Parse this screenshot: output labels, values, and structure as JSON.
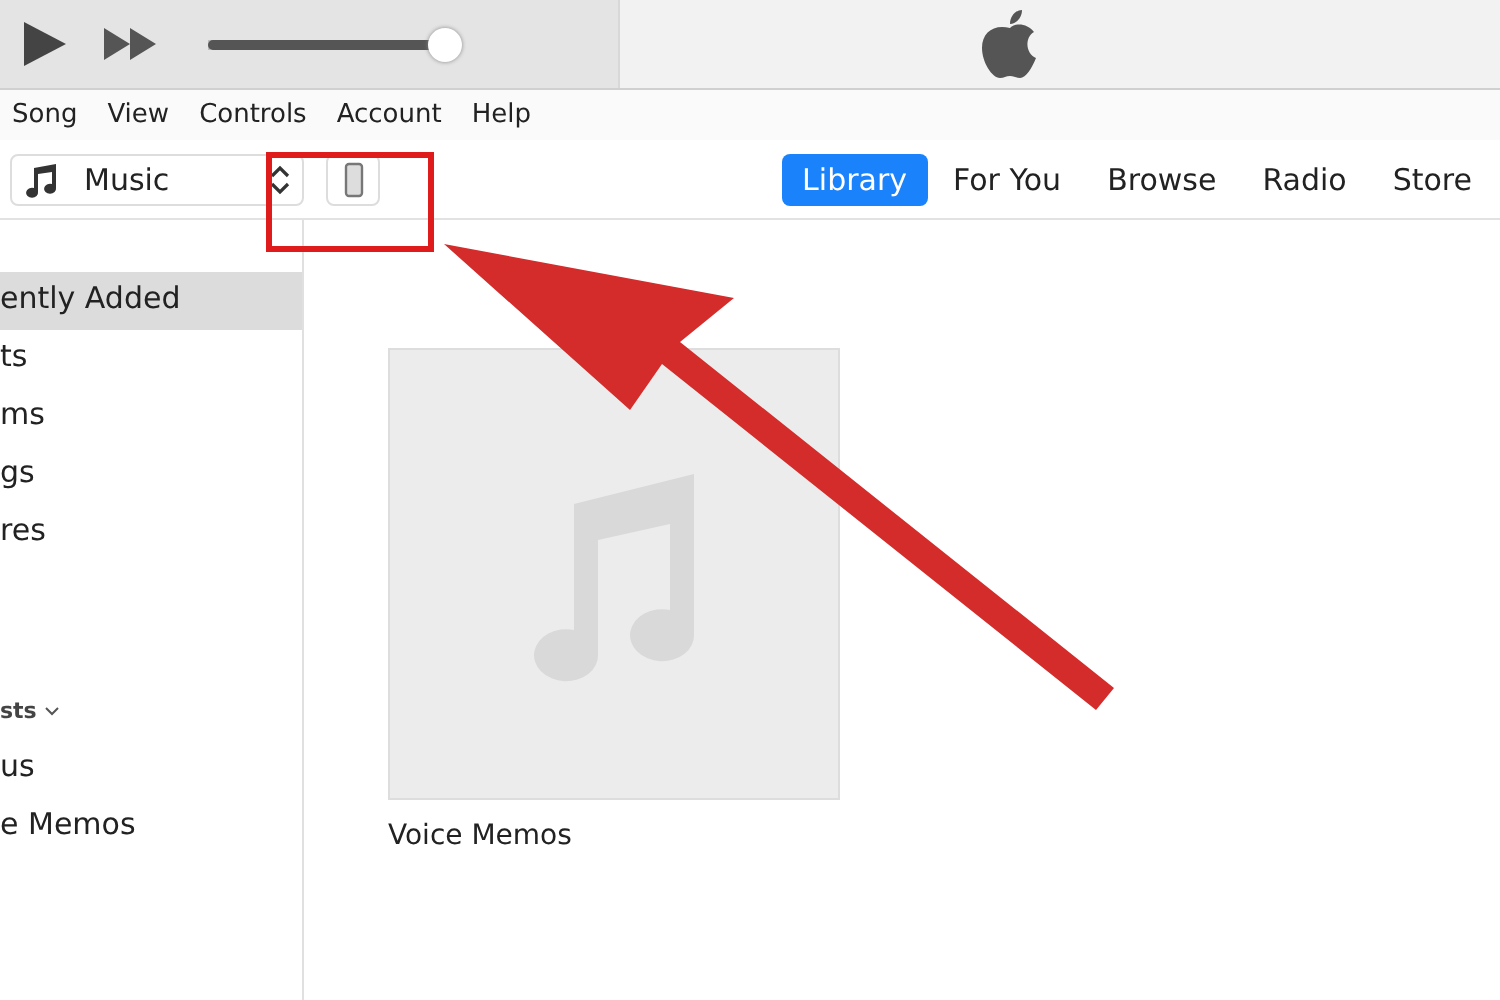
{
  "player": {
    "volume": {
      "level": 1
    }
  },
  "menu": [
    "Song",
    "View",
    "Controls",
    "Account",
    "Help"
  ],
  "media_picker": {
    "value": "Music"
  },
  "tabs": [
    {
      "label": "Library",
      "selected": true
    },
    {
      "label": "For You",
      "selected": false
    },
    {
      "label": "Browse",
      "selected": false
    },
    {
      "label": "Radio",
      "selected": false
    },
    {
      "label": "Store",
      "selected": false
    }
  ],
  "sidebar": {
    "items": [
      {
        "kind": "item",
        "label": "ently Added",
        "selected": true
      },
      {
        "kind": "item",
        "label": "ts",
        "selected": false
      },
      {
        "kind": "item",
        "label": "ms",
        "selected": false
      },
      {
        "kind": "item",
        "label": "gs",
        "selected": false
      },
      {
        "kind": "item",
        "label": "res",
        "selected": false
      },
      {
        "kind": "gap"
      },
      {
        "kind": "heading",
        "label": "sts"
      },
      {
        "kind": "item",
        "label": "us",
        "selected": false
      },
      {
        "kind": "item",
        "label": "e Memos",
        "selected": false
      }
    ]
  },
  "albums": [
    {
      "title": "Voice Memos"
    }
  ]
}
